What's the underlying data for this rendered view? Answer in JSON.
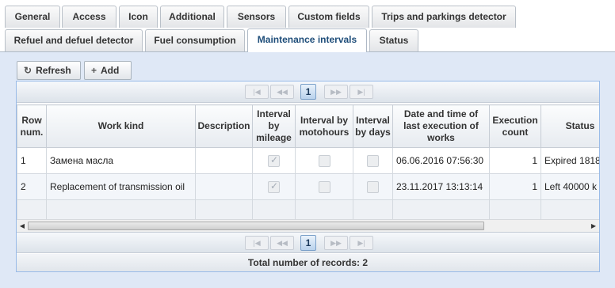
{
  "tabs": {
    "row1": [
      "General",
      "Access",
      "Icon",
      "Additional",
      "Sensors",
      "Custom fields",
      "Trips and parkings detector"
    ],
    "row2": [
      "Refuel and defuel detector",
      "Fuel consumption",
      "Maintenance intervals",
      "Status"
    ],
    "active": "Maintenance intervals"
  },
  "toolbar": {
    "refresh_label": "Refresh",
    "add_label": "Add"
  },
  "pager": {
    "current_page": "1",
    "first_icon": "first-page-icon",
    "prev_icon": "prev-page-icon",
    "next_icon": "next-page-icon",
    "last_icon": "last-page-icon"
  },
  "table": {
    "columns": [
      "Row num.",
      "Work kind",
      "Description",
      "Interval by mileage",
      "Interval by motohours",
      "Interval by days",
      "Date and time of last execution of works",
      "Execution count",
      "Status"
    ],
    "rows": [
      {
        "row_num": "1",
        "work_kind": "Замена масла",
        "description": "",
        "by_mileage": true,
        "by_motohours": false,
        "by_days": false,
        "last_execution": "06.06.2016 07:56:30",
        "execution_count": "1",
        "status": "Expired 1818"
      },
      {
        "row_num": "2",
        "work_kind": "Replacement of transmission oil",
        "description": "",
        "by_mileage": true,
        "by_motohours": false,
        "by_days": false,
        "last_execution": "23.11.2017 13:13:14",
        "execution_count": "1",
        "status": "Left 40000 k"
      }
    ]
  },
  "footer": {
    "total_label": "Total number of records: 2"
  }
}
